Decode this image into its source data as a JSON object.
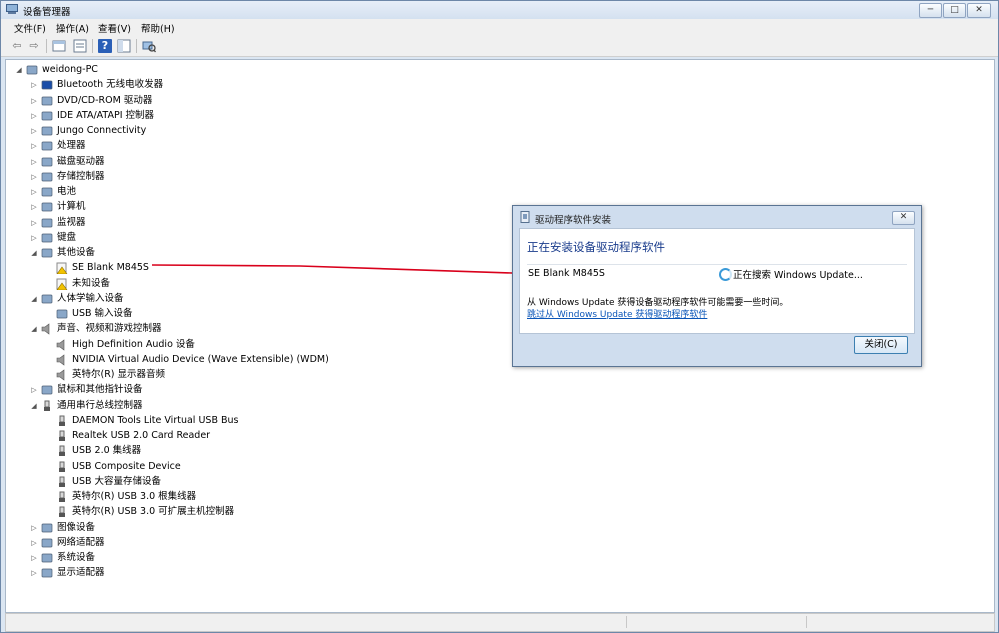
{
  "window": {
    "title": "设备管理器"
  },
  "window_buttons": {
    "minimize": "─",
    "maximize": "□",
    "close": "✕"
  },
  "menu": [
    "文件(F)",
    "操作(A)",
    "查看(V)",
    "帮助(H)"
  ],
  "toolbar": {
    "icons": [
      "back-icon",
      "forward-icon",
      "properties-icon",
      "show-hide-icon",
      "help-icon",
      "console-tree-icon",
      "scan-hardware-icon"
    ],
    "glyphs": {
      "back": "⇦",
      "forward": "⇨",
      "help": "?"
    }
  },
  "tree": {
    "expand_glyphs": {
      "collapsed": "▷",
      "expanded": "◢"
    },
    "root": {
      "label": "weidong-PC",
      "expanded": true
    },
    "nodes": [
      {
        "label": "Bluetooth 无线电收发器",
        "icon": "bluetooth-icon",
        "expanded": false
      },
      {
        "label": "DVD/CD-ROM 驱动器",
        "icon": "dvd-drive-icon",
        "expanded": false
      },
      {
        "label": "IDE ATA/ATAPI 控制器",
        "icon": "ide-controller-icon",
        "expanded": false
      },
      {
        "label": "Jungo Connectivity",
        "icon": "jungo-icon",
        "expanded": false
      },
      {
        "label": "处理器",
        "icon": "processor-icon",
        "expanded": false
      },
      {
        "label": "磁盘驱动器",
        "icon": "disk-drive-icon",
        "expanded": false
      },
      {
        "label": "存储控制器",
        "icon": "storage-controller-icon",
        "expanded": false
      },
      {
        "label": "电池",
        "icon": "battery-icon",
        "expanded": false
      },
      {
        "label": "计算机",
        "icon": "computer-icon",
        "expanded": false
      },
      {
        "label": "监视器",
        "icon": "monitor-icon",
        "expanded": false
      },
      {
        "label": "键盘",
        "icon": "keyboard-icon",
        "expanded": false
      },
      {
        "label": "其他设备",
        "icon": "other-devices-icon",
        "expanded": true,
        "children": [
          {
            "label": "SE Blank M845S",
            "icon": "unknown-device-warning-icon"
          },
          {
            "label": "未知设备",
            "icon": "unknown-device-warning-icon"
          }
        ]
      },
      {
        "label": "人体学输入设备",
        "icon": "hid-icon",
        "expanded": true,
        "children": [
          {
            "label": "USB 输入设备",
            "icon": "hid-device-icon"
          }
        ]
      },
      {
        "label": "声音、视频和游戏控制器",
        "icon": "sound-icon",
        "expanded": true,
        "children": [
          {
            "label": "High Definition Audio 设备",
            "icon": "speaker-icon"
          },
          {
            "label": "NVIDIA Virtual Audio Device (Wave Extensible) (WDM)",
            "icon": "speaker-icon"
          },
          {
            "label": "英特尔(R) 显示器音频",
            "icon": "speaker-icon"
          }
        ]
      },
      {
        "label": "鼠标和其他指针设备",
        "icon": "mouse-icon",
        "expanded": false
      },
      {
        "label": "通用串行总线控制器",
        "icon": "usb-icon",
        "expanded": true,
        "children": [
          {
            "label": "DAEMON Tools Lite Virtual USB Bus",
            "icon": "usb-plug-icon"
          },
          {
            "label": "Realtek USB 2.0 Card Reader",
            "icon": "usb-plug-icon"
          },
          {
            "label": "USB 2.0 集线器",
            "icon": "usb-plug-icon"
          },
          {
            "label": "USB Composite Device",
            "icon": "usb-plug-icon"
          },
          {
            "label": "USB 大容量存储设备",
            "icon": "usb-plug-icon"
          },
          {
            "label": "英特尔(R) USB 3.0 根集线器",
            "icon": "usb-plug-icon"
          },
          {
            "label": "英特尔(R) USB 3.0 可扩展主机控制器",
            "icon": "usb-plug-icon"
          }
        ]
      },
      {
        "label": "图像设备",
        "icon": "imaging-icon",
        "expanded": false
      },
      {
        "label": "网络适配器",
        "icon": "network-adapter-icon",
        "expanded": false
      },
      {
        "label": "系统设备",
        "icon": "system-devices-icon",
        "expanded": false
      },
      {
        "label": "显示适配器",
        "icon": "display-adapter-icon",
        "expanded": false
      }
    ]
  },
  "annotation": {
    "color": "#d9001b",
    "connects": [
      "SE Blank M845S",
      "SE Blank M845S"
    ]
  },
  "dialog": {
    "title": "驱动程序软件安装",
    "close_glyph": "✕",
    "heading": "正在安装设备驱动程序软件",
    "device": "SE Blank M845S",
    "status": "正在搜索 Windows Update...",
    "info": "从 Windows Update 获得设备驱动程序软件可能需要一些时间。",
    "link": "跳过从 Windows Update 获得驱动程序软件",
    "close_button": "关闭(C)"
  },
  "colors": {
    "heading": "#1a3c8c",
    "link": "#0a55b8",
    "warning": "#f2c200"
  }
}
